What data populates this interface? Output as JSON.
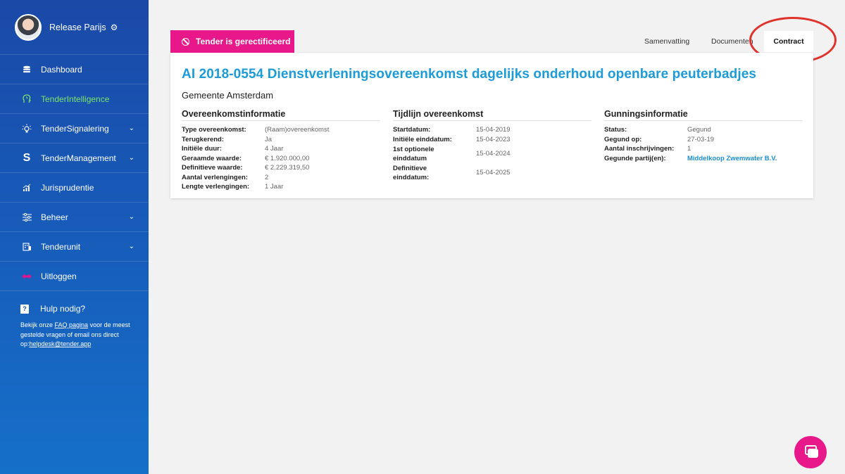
{
  "profile": {
    "name": "Release Parijs"
  },
  "nav": [
    {
      "label": "Dashboard",
      "icon": "database-icon",
      "has_chevron": false,
      "active": false
    },
    {
      "label": "TenderIntelligence",
      "icon": "brain-icon",
      "has_chevron": false,
      "active": true
    },
    {
      "label": "TenderSignalering",
      "icon": "lightbulb-icon",
      "has_chevron": true,
      "active": false
    },
    {
      "label": "TenderManagement",
      "icon": "s-logo-icon",
      "has_chevron": true,
      "active": false
    },
    {
      "label": "Jurisprudentie",
      "icon": "chart-icon",
      "has_chevron": false,
      "active": false
    },
    {
      "label": "Beheer",
      "icon": "sliders-icon",
      "has_chevron": true,
      "active": false
    },
    {
      "label": "Tenderunit",
      "icon": "building-icon",
      "has_chevron": true,
      "active": false
    },
    {
      "label": "Uitloggen",
      "icon": "logout-icon",
      "has_chevron": false,
      "active": false
    }
  ],
  "help": {
    "title": "Hulp nodig?",
    "text_1": "Bekijk onze ",
    "faq_link": "FAQ pagina",
    "text_2": " voor de meest gestelde vragen of email ons direct op:",
    "email": "helpdesk@tender.app"
  },
  "badge": "Tender is gerectificeerd",
  "tabs": {
    "summary": "Samenvatting",
    "documents": "Documenten",
    "contract": "Contract"
  },
  "tender": {
    "title": "AI 2018-0554 Dienstverleningsovereenkomst dagelijks onderhoud openbare peuterbadjes",
    "organization": "Gemeente Amsterdam"
  },
  "sections": {
    "agreement": {
      "heading": "Overeenkomstinformatie",
      "rows": [
        [
          "Type overeenkomst:",
          "(Raam)overeenkomst"
        ],
        [
          "Terugkerend:",
          "Ja"
        ],
        [
          "Initiële duur:",
          "4 Jaar"
        ],
        [
          "Geraamde waarde:",
          "€ 1.920.000,00"
        ],
        [
          "Definitieve waarde:",
          "€ 2.229.319,50"
        ],
        [
          "Aantal verlengingen:",
          "2"
        ],
        [
          "Lengte verlengingen:",
          "1 Jaar"
        ]
      ]
    },
    "timeline": {
      "heading": "Tijdlijn overeenkomst",
      "rows": [
        [
          "Startdatum:",
          "15-04-2019"
        ],
        [
          "Initiële einddatum:",
          "15-04-2023"
        ],
        [
          "1st optionele einddatum",
          "15-04-2024"
        ],
        [
          "Definitieve einddatum:",
          "15-04-2025"
        ]
      ]
    },
    "award": {
      "heading": "Gunningsinformatie",
      "rows": [
        [
          "Status:",
          "Gegund"
        ],
        [
          "Gegund op:",
          "27-03-19"
        ],
        [
          "Aantal inschrijvingen:",
          "1"
        ],
        [
          "Gegunde partij(en):",
          "Middelkoop Zwemwater B.V."
        ]
      ]
    }
  },
  "colors": {
    "accent_pink": "#e8178a",
    "title_blue": "#1c9bd6",
    "highlight_red": "#e0322d",
    "active_green": "#7ee36a"
  }
}
